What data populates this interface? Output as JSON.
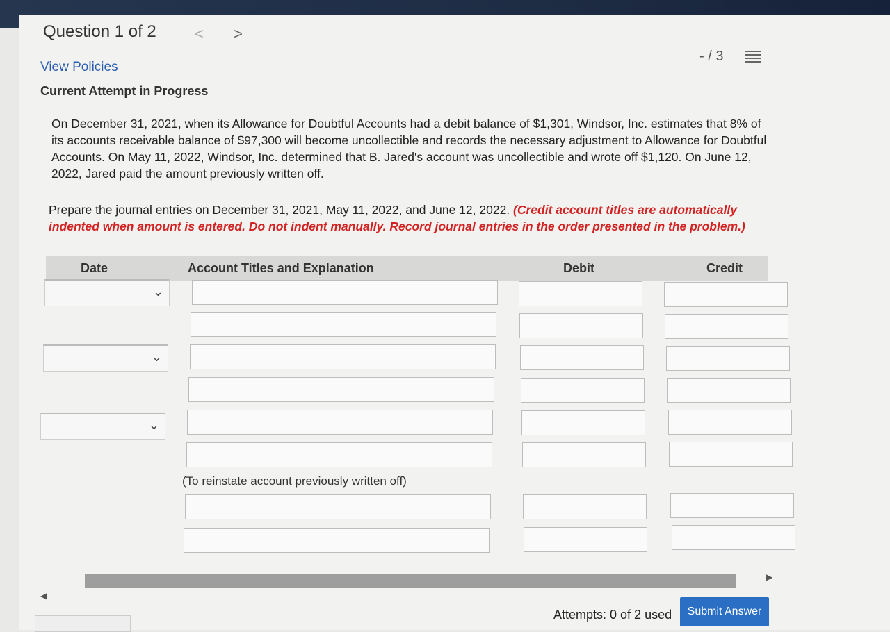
{
  "header": {
    "question_label": "Question 1 of 2",
    "prev_icon": "chevron-left-icon",
    "next_icon": "chevron-right-icon",
    "score": "- / 3",
    "list_icon": "list-icon"
  },
  "links": {
    "view_policies": "View Policies"
  },
  "status": {
    "attempt": "Current Attempt in Progress"
  },
  "problem": {
    "text": "On December 31, 2021, when its Allowance for Doubtful Accounts had a debit balance of $1,301, Windsor, Inc. estimates that 8% of its accounts receivable balance of $97,300 will become uncollectible and records the necessary adjustment to Allowance for Doubtful Accounts. On May 11, 2022, Windsor, Inc. determined that B. Jared's account was uncollectible and wrote off $1,120. On June 12, 2022, Jared paid the amount previously written off."
  },
  "instructions": {
    "text": "Prepare the journal entries on December 31, 2021, May 11, 2022, and June 12, 2022.",
    "note": "(Credit account titles are automatically indented when amount is entered. Do not indent manually. Record journal entries in the order presented in the problem.)"
  },
  "table": {
    "headers": {
      "date": "Date",
      "account": "Account Titles and Explanation",
      "debit": "Debit",
      "credit": "Credit"
    },
    "reinstate_note": "(To reinstate account previously written off)"
  },
  "footer": {
    "attempts": "Attempts: 0 of 2 used",
    "submit_label": "Submit Answer"
  },
  "colors": {
    "accent": "#2b6fc4",
    "instruction_red": "#d32222",
    "topbar": "#1e2c44"
  }
}
